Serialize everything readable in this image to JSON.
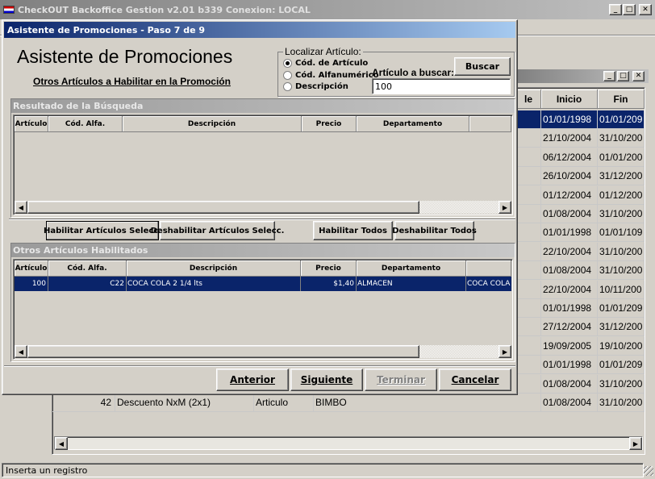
{
  "main_window": {
    "title": "CheckOUT Backoffice Gestion v2.01 b339 Conexion: LOCAL"
  },
  "status_bar": {
    "text": "Inserta un registro"
  },
  "bg_grid": {
    "headers": {
      "le": "le",
      "inicio": "Inicio",
      "fin": "Fin"
    },
    "rows": [
      {
        "inicio": "01/01/1998",
        "fin": "01/01/209"
      },
      {
        "inicio": "21/10/2004",
        "fin": "31/10/200"
      },
      {
        "inicio": "06/12/2004",
        "fin": "01/01/200"
      },
      {
        "inicio": "26/10/2004",
        "fin": "31/12/200"
      },
      {
        "inicio": "01/12/2004",
        "fin": "01/12/200"
      },
      {
        "inicio": "01/08/2004",
        "fin": "31/10/200"
      },
      {
        "inicio": "01/01/1998",
        "fin": "01/01/109"
      },
      {
        "inicio": "22/10/2004",
        "fin": "31/10/200"
      },
      {
        "inicio": "01/08/2004",
        "fin": "31/10/200"
      },
      {
        "inicio": "22/10/2004",
        "fin": "10/11/200"
      },
      {
        "inicio": "01/01/1998",
        "fin": "01/01/209"
      },
      {
        "inicio": "27/12/2004",
        "fin": "31/12/200"
      },
      {
        "inicio": "19/09/2005",
        "fin": "19/10/200"
      },
      {
        "inicio": "01/01/1998",
        "fin": "01/01/209"
      },
      {
        "inicio": "01/08/2004",
        "fin": "31/10/200"
      },
      {
        "num": "42",
        "desc": "Descuento NxM (2x1)",
        "tipo": "Articulo",
        "marca": "BIMBO",
        "inicio": "01/08/2004",
        "fin": "31/10/200"
      }
    ]
  },
  "dialog": {
    "title": "Asistente de Promociones - Paso 7 de 9",
    "heading": "Asistente de Promociones",
    "subheading": "Otros Artículos a Habilitar en la Promoción",
    "locate": {
      "legend": "Localizar Artículo:",
      "options": [
        "Cód. de Artículo",
        "Cód. Alfanumérico",
        "Descripción"
      ],
      "search_label": "Artículo a buscar:",
      "search_value": "100",
      "search_button": "Buscar"
    },
    "results": {
      "title": "Resultado de la Búsqueda",
      "columns": [
        "Artículo",
        "Cód. Alfa.",
        "Descripción",
        "Precio",
        "Departamento"
      ]
    },
    "actions": {
      "enable_selected": "Habilitar Artículos Selecc.",
      "disable_selected": "Deshabilitar Artículos Selecc.",
      "enable_all": "Habilitar Todos",
      "disable_all": "Deshabilitar Todos"
    },
    "enabled": {
      "title": "Otros Artículos Habilitados",
      "columns": [
        "Artículo",
        "Cód. Alfa.",
        "Descripción",
        "Precio",
        "Departamento"
      ],
      "rows": [
        {
          "articulo": "100",
          "cod_alfa": "C22",
          "descripcion": "COCA COLA 2 1/4 lts",
          "precio": "$1,40",
          "departamento": "ALMACEN",
          "extra": "COCA COLA"
        }
      ]
    },
    "nav": {
      "back": "Anterior",
      "next": "Siguiente",
      "finish": "Terminar",
      "cancel": "Cancelar"
    }
  }
}
